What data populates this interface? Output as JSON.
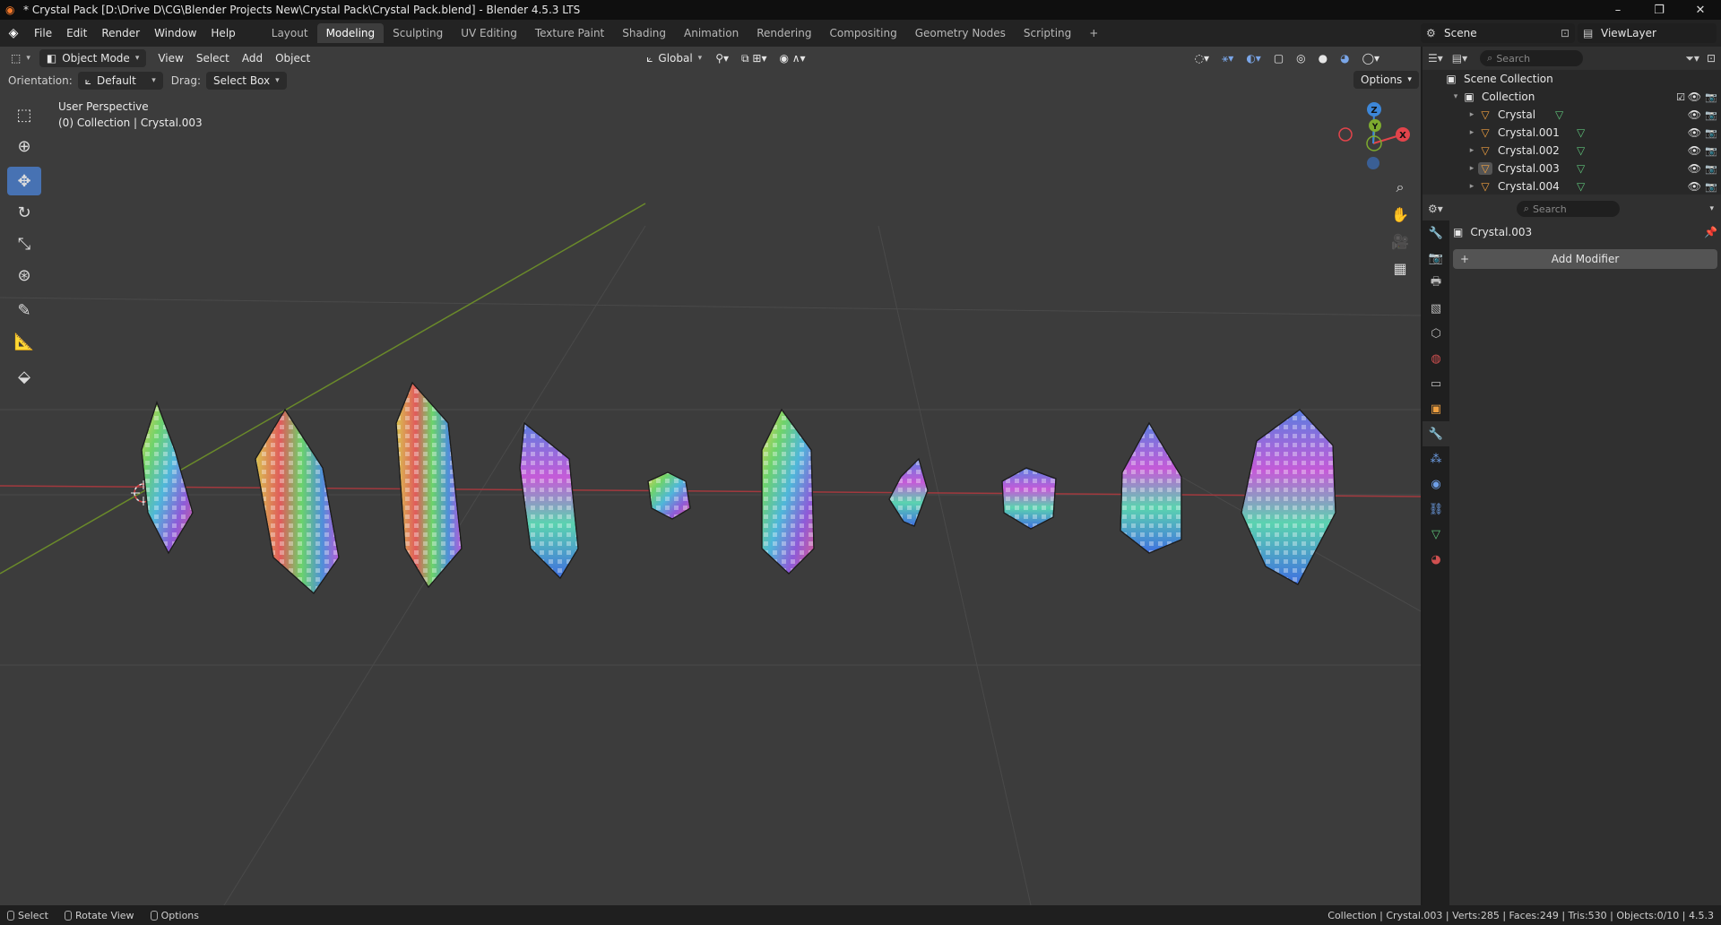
{
  "window": {
    "title": "* Crystal Pack [D:\\Drive D\\CG\\Blender Projects New\\Crystal Pack\\Crystal Pack.blend] - Blender 4.5.3 LTS",
    "controls": [
      "–",
      "❐",
      "✕"
    ]
  },
  "menu": [
    "File",
    "Edit",
    "Render",
    "Window",
    "Help"
  ],
  "workspaces": [
    {
      "label": "Layout",
      "active": false
    },
    {
      "label": "Modeling",
      "active": true
    },
    {
      "label": "Sculpting",
      "active": false
    },
    {
      "label": "UV Editing",
      "active": false
    },
    {
      "label": "Texture Paint",
      "active": false
    },
    {
      "label": "Shading",
      "active": false
    },
    {
      "label": "Animation",
      "active": false
    },
    {
      "label": "Rendering",
      "active": false
    },
    {
      "label": "Compositing",
      "active": false
    },
    {
      "label": "Geometry Nodes",
      "active": false
    },
    {
      "label": "Scripting",
      "active": false
    }
  ],
  "scene": {
    "label": "Scene"
  },
  "view_layer": {
    "label": "ViewLayer"
  },
  "viewport": {
    "mode": "Object Mode",
    "menu": [
      "View",
      "Select",
      "Add",
      "Object"
    ],
    "transform_orientation": "Global",
    "orientation_label": "Orientation:",
    "orientation_value": "Default",
    "drag_label": "Drag:",
    "drag_value": "Select Box",
    "options": "Options",
    "overlay_line1": "User Perspective",
    "overlay_line2": "(0) Collection | Crystal.003",
    "gizmo": {
      "z": "Z",
      "y": "Y",
      "x": "X"
    }
  },
  "outliner": {
    "search_placeholder": "Search",
    "scene_collection": "Scene Collection",
    "collection": "Collection",
    "items": [
      {
        "name": "Crystal",
        "selected": false
      },
      {
        "name": "Crystal.001",
        "selected": false
      },
      {
        "name": "Crystal.002",
        "selected": false
      },
      {
        "name": "Crystal.003",
        "selected": true
      },
      {
        "name": "Crystal.004",
        "selected": false
      }
    ]
  },
  "properties": {
    "search_placeholder": "Search",
    "object_name": "Crystal.003",
    "add_modifier": "Add Modifier"
  },
  "status": {
    "hints": [
      "Select",
      "Rotate View",
      "Options"
    ],
    "stats": "Collection | Crystal.003 | Verts:285 | Faces:249 | Tris:530 | Objects:0/10 | 4.5.3"
  },
  "colors": {
    "accent": "#4772b3",
    "x_axis": "#e2444b",
    "y_axis": "#7eab2f",
    "z_axis": "#3d87d9"
  }
}
